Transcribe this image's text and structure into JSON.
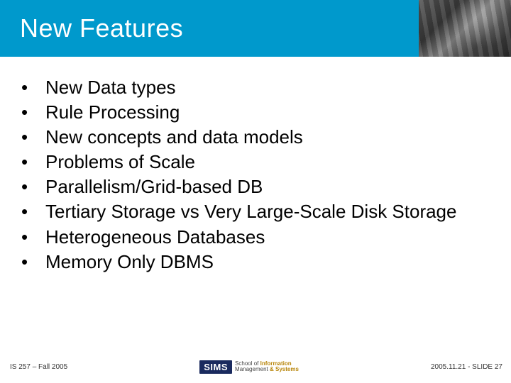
{
  "slide": {
    "title": "New Features",
    "bullets": [
      "New Data types",
      "Rule Processing",
      "New concepts and data models",
      "Problems of Scale",
      "Parallelism/Grid-based DB",
      "Tertiary Storage vs Very Large-Scale Disk Storage",
      "Heterogeneous Databases",
      "Memory Only DBMS"
    ]
  },
  "footer": {
    "left": "IS 257 – Fall 2005",
    "logo_text": "SIMS",
    "logo_sub1": "School of",
    "logo_sub2a": "Information",
    "logo_sub2b": "Management",
    "logo_sub2c": "& Systems",
    "right": "2005.11.21 - SLIDE 27"
  }
}
